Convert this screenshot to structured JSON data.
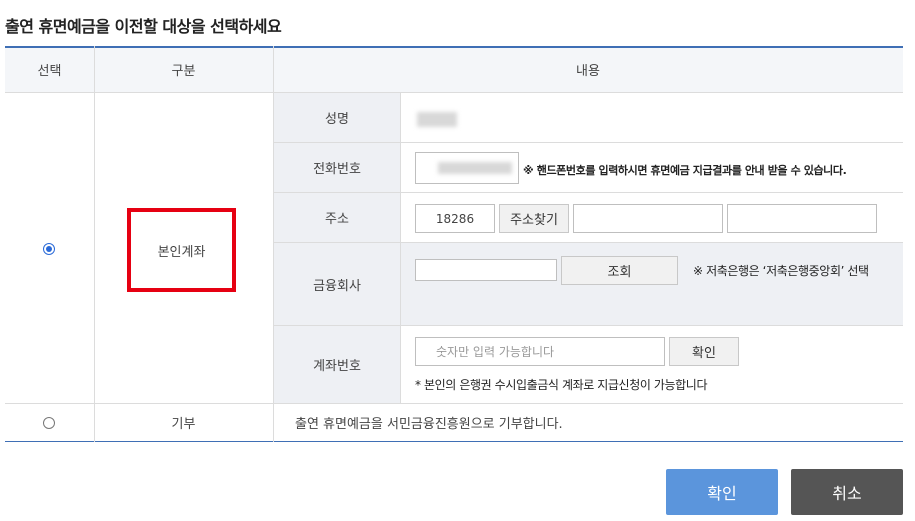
{
  "title": "출연 휴면예금을 이전할 대상을 선택하세요",
  "table": {
    "headers": {
      "select": "선택",
      "category": "구분",
      "content": "내용"
    },
    "rows": [
      {
        "category": "본인계좌",
        "selected": true
      },
      {
        "category": "기부",
        "selected": false,
        "content": "출연 휴면예금을 서민금융진흥원으로 기부합니다."
      }
    ],
    "fields": {
      "name_label": "성명",
      "phone_label": "전화번호",
      "phone_note": "※ 핸드폰번호를 입력하시면 휴면예금 지급결과를 안내 받을 수 있습니다.",
      "address_label": "주소",
      "zip_value": "18286",
      "address_search_button": "주소찾기",
      "bank_label": "금융회사",
      "bank_search_button": "조회",
      "bank_note": "※ 저축은행은 ‘저축은행중앙회’ 선택",
      "account_label": "계좌번호",
      "account_placeholder": "숫자만 입력 가능합니다",
      "account_confirm_button": "확인",
      "account_note": "* 본인의 은행권 수시입출금식 계좌로 지급신청이 가능합니다"
    }
  },
  "footer": {
    "confirm_label": "확인",
    "cancel_label": "취소"
  },
  "colors": {
    "confirm": "#5b95dc",
    "cancel": "#555555",
    "highlight": "#e60012",
    "top_border": "#3f6fb5"
  }
}
